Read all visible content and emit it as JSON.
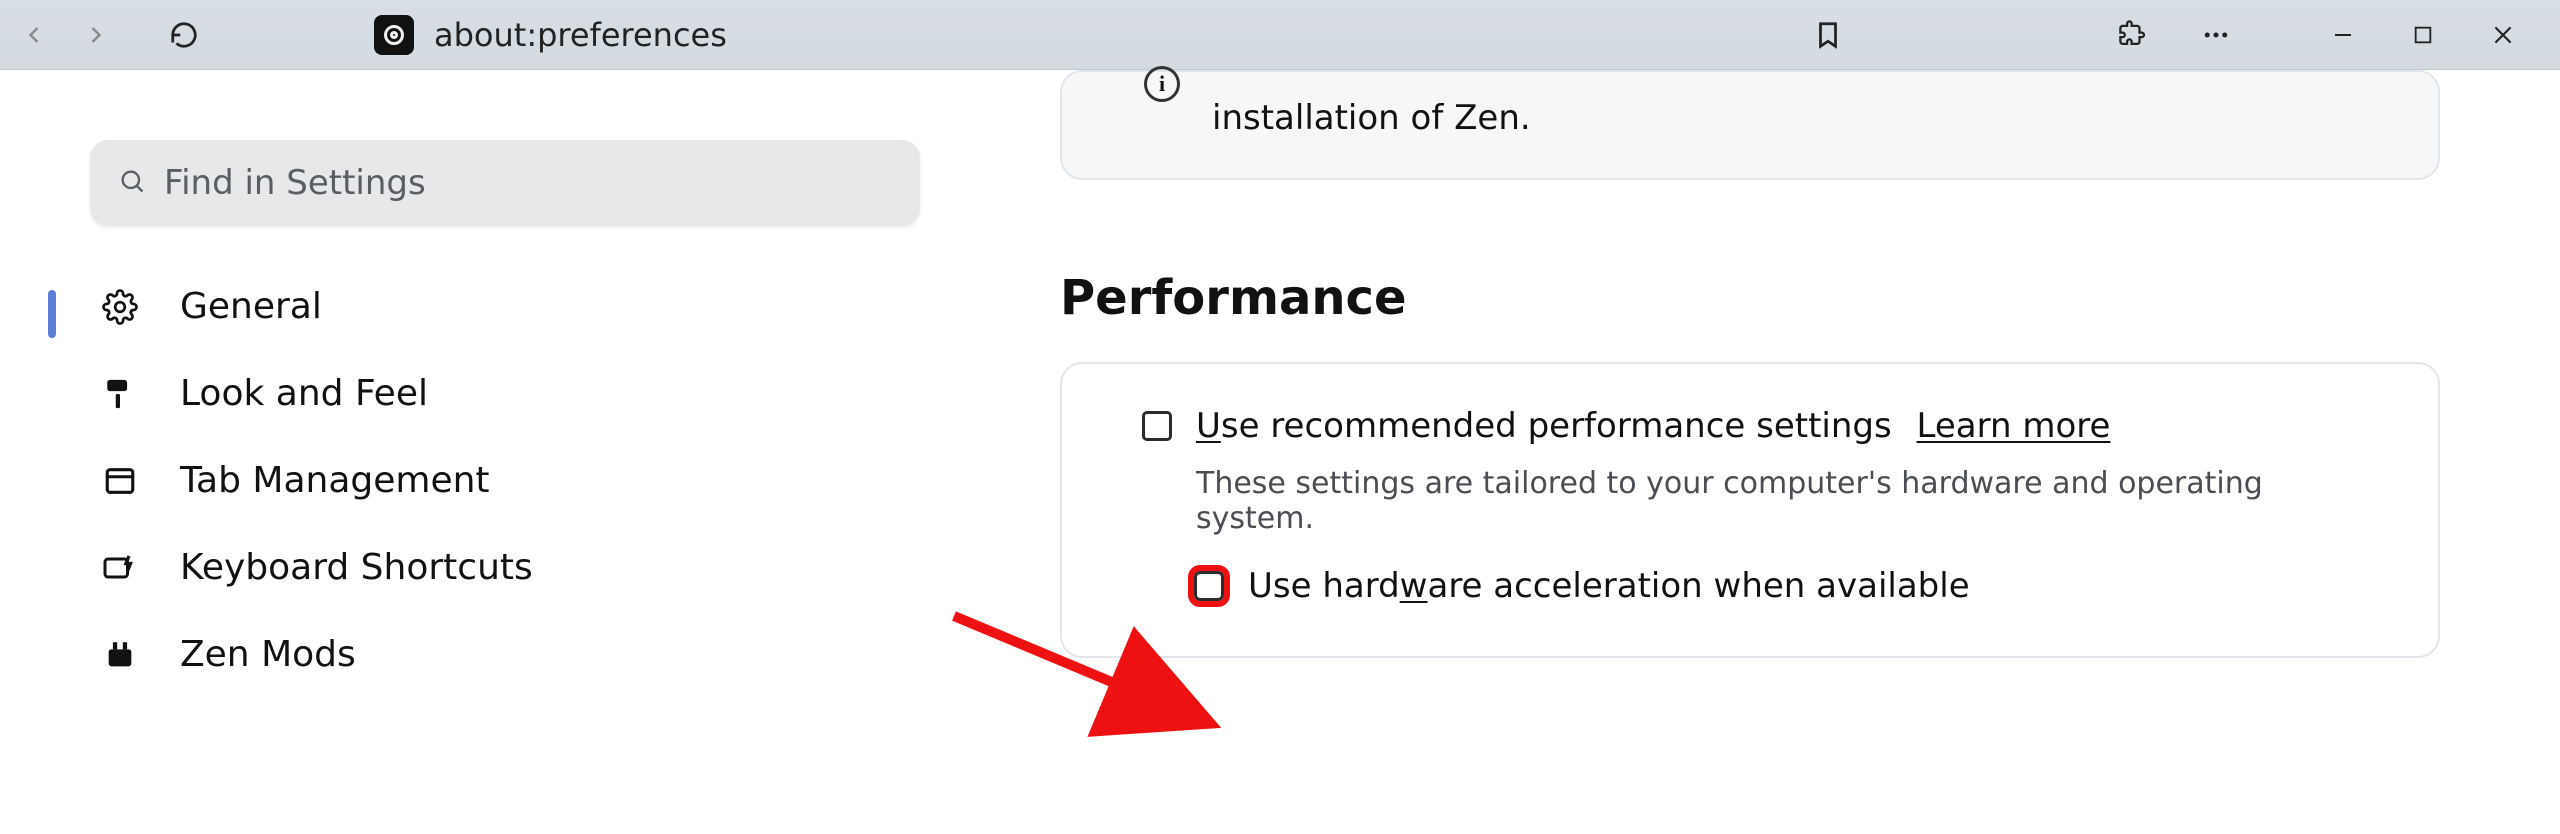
{
  "toolbar": {
    "url": "about:preferences"
  },
  "search": {
    "placeholder": "Find in Settings"
  },
  "sidebar": {
    "items": [
      {
        "label": "General"
      },
      {
        "label": "Look and Feel"
      },
      {
        "label": "Tab Management"
      },
      {
        "label": "Keyboard Shortcuts"
      },
      {
        "label": "Zen Mods"
      }
    ]
  },
  "notice": {
    "text_fragment": "installation of Zen."
  },
  "performance": {
    "heading": "Performance",
    "use_recommended_prefix_u": "U",
    "use_recommended_rest": "se recommended performance settings",
    "learn_more": "Learn more",
    "desc": "These settings are tailored to your computer's hardware and operating system.",
    "hw_accel_pre": "Use hard",
    "hw_accel_w": "w",
    "hw_accel_post": "are acceleration when available"
  }
}
